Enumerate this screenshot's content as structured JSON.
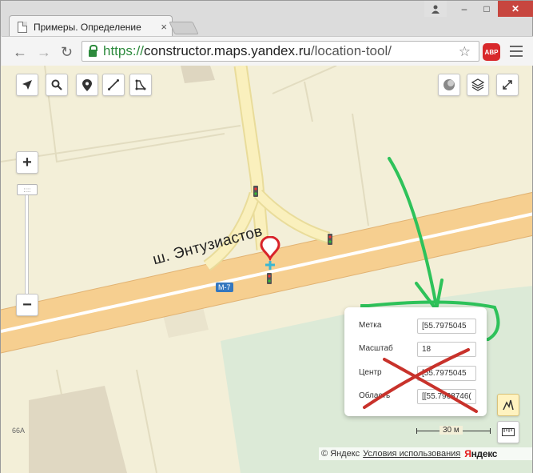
{
  "browser": {
    "tab_title": "Примеры. Определение",
    "tab_close": "×",
    "window_user_icon": "user-icon",
    "window_min": "‒",
    "window_max": "□",
    "window_close": "✕",
    "url": {
      "scheme": "https://",
      "host": "constructor.maps.yandex.ru",
      "path": "/location-tool/"
    },
    "adblock_label": "ABP",
    "accent_color": "#2e8b3e"
  },
  "map": {
    "road_label": "ш. Энтузиастов",
    "route_badge": "M-7",
    "building_number": "66А",
    "toolbar_icons": [
      "location-arrow-icon",
      "search-icon",
      "placemark-icon",
      "ruler-line-icon",
      "polygon-icon"
    ],
    "right_icons": [
      "traffic-icon",
      "layers-icon",
      "fullscreen-icon"
    ],
    "zoom_in": "+",
    "zoom_out": "−",
    "zoom_thumb": "::::",
    "panel": {
      "rows": [
        {
          "label": "Метка",
          "value": "[55.7975045"
        },
        {
          "label": "Масштаб",
          "value": "18"
        },
        {
          "label": "Центр",
          "value": "[55.7975045"
        },
        {
          "label": "Область",
          "value": "[[55.7968746("
        }
      ]
    },
    "scale_text": "30 м",
    "copyright": "© Яндекс",
    "terms": "Условия использования",
    "logo_main": "Я",
    "logo_rest": "ндекс",
    "annotation_colors": {
      "green": "#2ec25a",
      "red": "#c8322b"
    }
  }
}
